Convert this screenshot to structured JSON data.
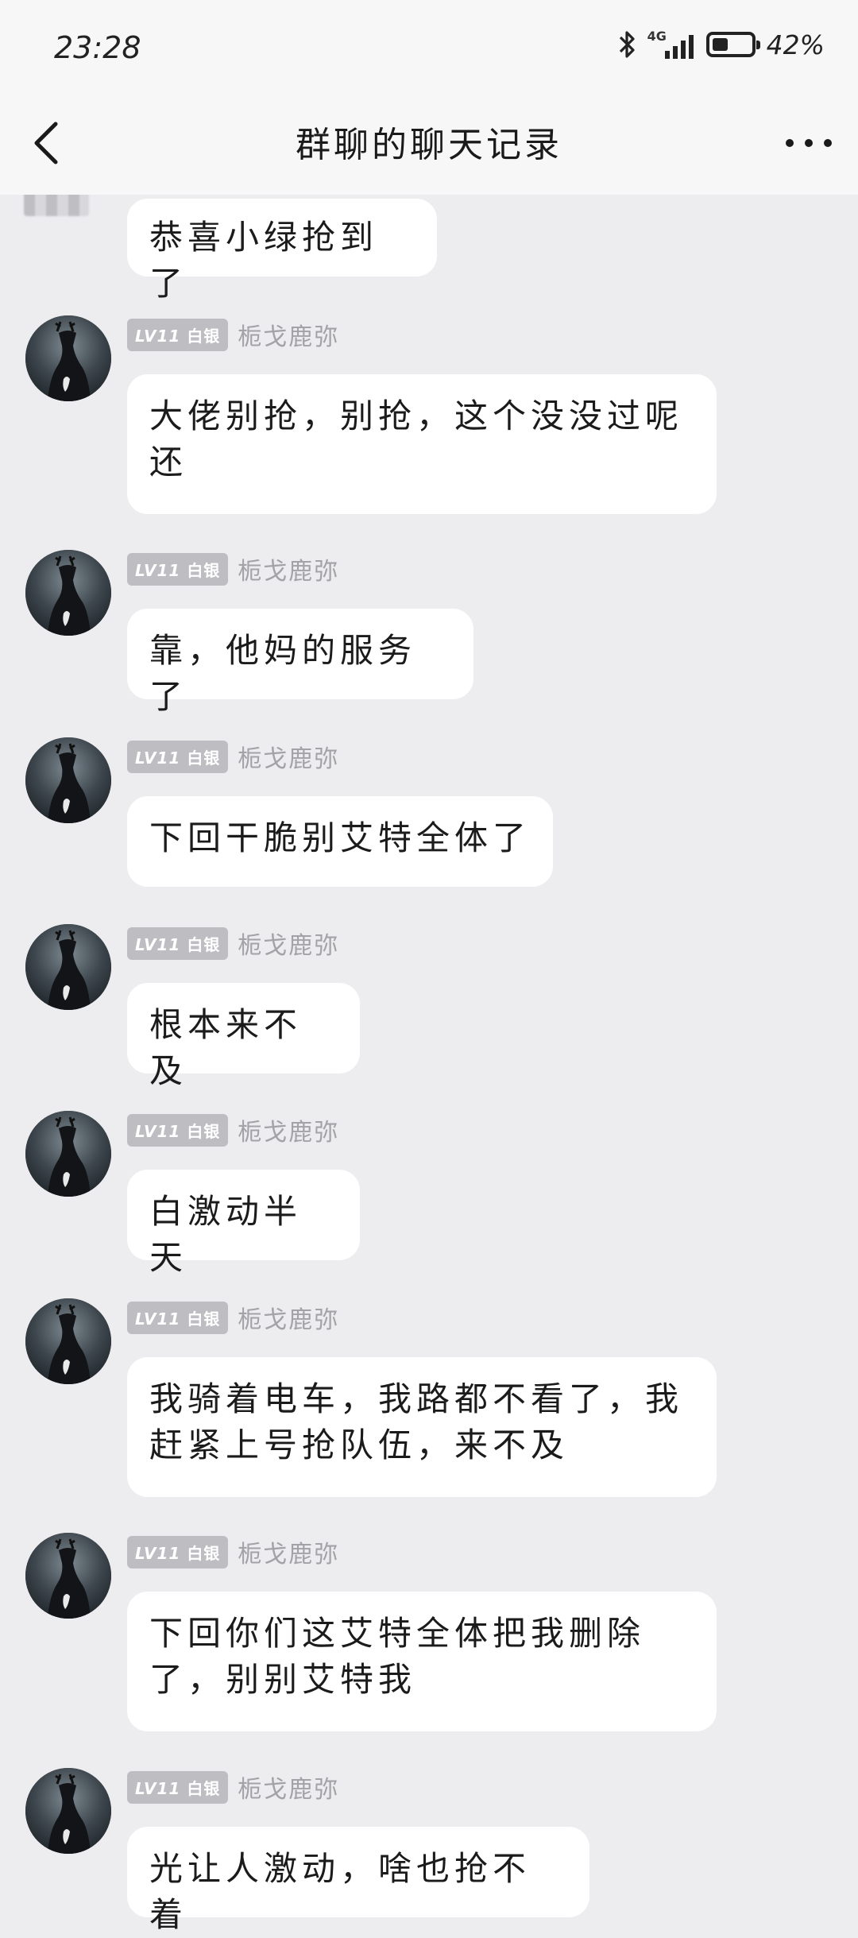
{
  "status_bar": {
    "time": "23:28",
    "network": "4G",
    "battery": "42%",
    "battery_level": 0.42
  },
  "nav": {
    "title": "群聊的聊天记录",
    "back_icon": "chevron-left-icon",
    "more_icon": "more-horizontal-icon"
  },
  "messages": [
    {
      "text": "恭喜小绿抢到了"
    },
    {
      "badge_level": "LV11",
      "badge_title": "白银",
      "sender": "栀戈鹿弥",
      "text": "大佬别抢，别抢，这个没没过呢还"
    },
    {
      "badge_level": "LV11",
      "badge_title": "白银",
      "sender": "栀戈鹿弥",
      "text": "靠，他妈的服务了"
    },
    {
      "badge_level": "LV11",
      "badge_title": "白银",
      "sender": "栀戈鹿弥",
      "text": "下回干脆别艾特全体了"
    },
    {
      "badge_level": "LV11",
      "badge_title": "白银",
      "sender": "栀戈鹿弥",
      "text": "根本来不及"
    },
    {
      "badge_level": "LV11",
      "badge_title": "白银",
      "sender": "栀戈鹿弥",
      "text": "白激动半天"
    },
    {
      "badge_level": "LV11",
      "badge_title": "白银",
      "sender": "栀戈鹿弥",
      "text": "我骑着电车，我路都不看了，我赶紧上号抢队伍，来不及"
    },
    {
      "badge_level": "LV11",
      "badge_title": "白银",
      "sender": "栀戈鹿弥",
      "text": "下回你们这艾特全体把我删除了，别别艾特我"
    },
    {
      "badge_level": "LV11",
      "badge_title": "白银",
      "sender": "栀戈鹿弥",
      "text": "光让人激动，啥也抢不着"
    }
  ]
}
